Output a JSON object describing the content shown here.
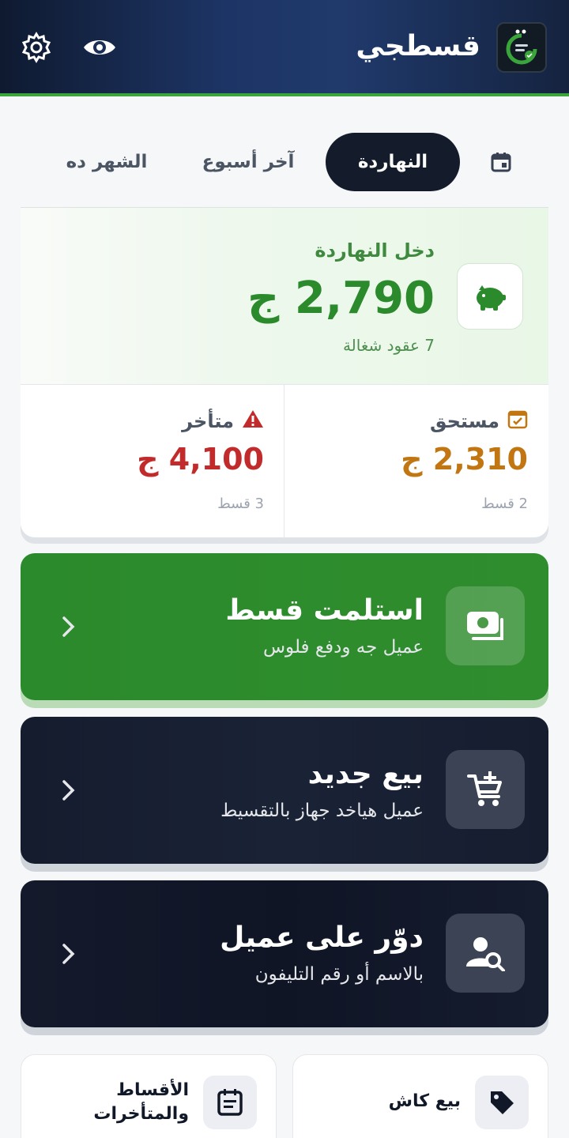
{
  "header": {
    "app_title": "قسطجي",
    "icons": [
      "app-logo",
      "eye-icon",
      "gear-icon"
    ]
  },
  "tabs": [
    {
      "label": "النهاردة",
      "active": true
    },
    {
      "label": "آخر أسبوع",
      "active": false
    },
    {
      "label": "الشهر ده",
      "active": false
    }
  ],
  "income": {
    "label": "دخل النهاردة",
    "amount": "2,790",
    "currency": "ج",
    "sub": "7 عقود شغالة"
  },
  "stats": {
    "due": {
      "label": "مستحق",
      "amount": "2,310",
      "currency": "ج",
      "sub": "2 قسط"
    },
    "late": {
      "label": "متأخر",
      "amount": "4,100",
      "currency": "ج",
      "sub": "3 قسط"
    }
  },
  "actions": [
    {
      "title": "استلمت قسط",
      "subtitle": "عميل جه ودفع فلوس",
      "icon": "cash-icon"
    },
    {
      "title": "بيع جديد",
      "subtitle": "عميل هياخد جهاز بالتقسيط",
      "icon": "cart-add-icon"
    },
    {
      "title": "دوّر على عميل",
      "subtitle": "بالاسم أو رقم التليفون",
      "icon": "user-search-icon"
    }
  ],
  "tiles": {
    "cash": {
      "label": "بيع كاش",
      "icon": "tag-icon"
    },
    "installments": {
      "label": "الأقساط والمتأخرات",
      "icon": "list-calendar-icon"
    }
  },
  "colors": {
    "green": "#2b8a2b",
    "dark": "#141b2b",
    "due": "#c17611",
    "late": "#c22b2b"
  }
}
